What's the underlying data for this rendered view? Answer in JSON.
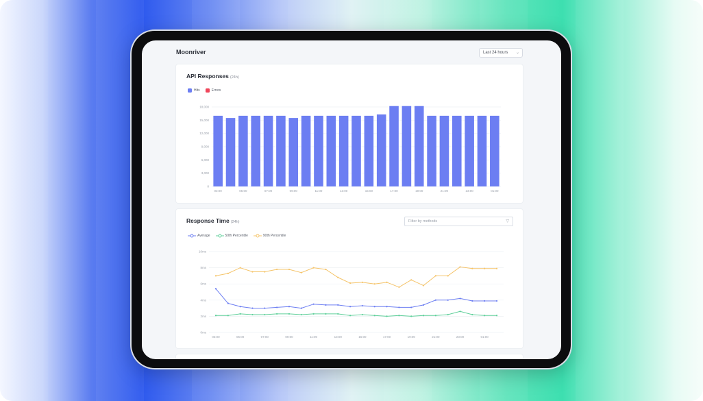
{
  "app": {
    "title": "Moonriver",
    "time_range": "Last 24 hours"
  },
  "colors": {
    "hits": "#6c7ef2",
    "errors": "#f0455a",
    "average": "#6c7ef2",
    "p50": "#5fcf9a",
    "p90": "#f5c46a"
  },
  "api_card": {
    "title": "API Responses",
    "subtitle": "(24h)",
    "legend": [
      "Hits",
      "Errors"
    ]
  },
  "response_card": {
    "title": "Response Time",
    "subtitle": "(24h)",
    "filter_placeholder": "Filter by methods",
    "legend": [
      "Average",
      "50th Percentile",
      "90th Percentile"
    ]
  },
  "chart_data": [
    {
      "type": "bar",
      "title": "API Responses",
      "categories": [
        "03:00",
        "04:00",
        "05:00",
        "06:00",
        "07:00",
        "08:00",
        "09:00",
        "10:00",
        "11:00",
        "12:00",
        "13:00",
        "14:00",
        "15:00",
        "16:00",
        "17:00",
        "18:00",
        "19:00",
        "20:00",
        "21:00",
        "22:00",
        "23:00",
        "00:00",
        "01:00"
      ],
      "x_tick_labels": [
        "03:00",
        "05:00",
        "07:00",
        "09:00",
        "11:00",
        "13:00",
        "15:00",
        "17:00",
        "19:00",
        "21:00",
        "23:00",
        "01:00"
      ],
      "series": [
        {
          "name": "Hits",
          "values": [
            16000,
            15500,
            16000,
            16000,
            16000,
            16000,
            15500,
            16000,
            16000,
            16000,
            16000,
            16000,
            16000,
            16300,
            18200,
            18200,
            18200,
            16000,
            16000,
            16000,
            16000,
            16000,
            16000
          ]
        },
        {
          "name": "Errors",
          "values": [
            0,
            0,
            0,
            0,
            0,
            0,
            0,
            0,
            0,
            0,
            0,
            0,
            0,
            0,
            0,
            0,
            0,
            0,
            0,
            0,
            0,
            0,
            0
          ]
        }
      ],
      "y_ticks": [
        "0",
        "3,000",
        "6,000",
        "9,000",
        "12,000",
        "15,000",
        "18,000"
      ],
      "ylim": [
        0,
        18000
      ],
      "grid": true,
      "legend_position": "top-left"
    },
    {
      "type": "line",
      "title": "Response Time",
      "x": [
        "03:00",
        "04:00",
        "05:00",
        "06:00",
        "07:00",
        "08:00",
        "09:00",
        "10:00",
        "11:00",
        "12:00",
        "13:00",
        "14:00",
        "15:00",
        "16:00",
        "17:00",
        "18:00",
        "19:00",
        "20:00",
        "21:00",
        "22:00",
        "23:00",
        "00:00",
        "01:00",
        "02:00"
      ],
      "x_tick_labels": [
        "03:00",
        "05:00",
        "07:00",
        "09:00",
        "11:00",
        "13:00",
        "15:00",
        "17:00",
        "19:00",
        "21:00",
        "23:00",
        "01:00"
      ],
      "series": [
        {
          "name": "Average",
          "values": [
            5.4,
            3.6,
            3.2,
            3.0,
            3.0,
            3.1,
            3.2,
            3.0,
            3.5,
            3.4,
            3.4,
            3.2,
            3.3,
            3.2,
            3.2,
            3.1,
            3.1,
            3.4,
            4.0,
            4.0,
            4.2,
            3.9,
            3.9,
            3.9
          ]
        },
        {
          "name": "50th Percentile",
          "values": [
            2.1,
            2.1,
            2.3,
            2.2,
            2.2,
            2.3,
            2.3,
            2.2,
            2.3,
            2.3,
            2.3,
            2.1,
            2.2,
            2.1,
            2.0,
            2.1,
            2.0,
            2.1,
            2.1,
            2.2,
            2.6,
            2.2,
            2.1,
            2.1
          ]
        },
        {
          "name": "90th Percentile",
          "values": [
            7.0,
            7.3,
            8.0,
            7.5,
            7.5,
            7.8,
            7.8,
            7.4,
            8.0,
            7.8,
            6.8,
            6.1,
            6.2,
            6.0,
            6.2,
            5.6,
            6.5,
            5.8,
            7.0,
            7.0,
            8.1,
            7.9,
            7.9,
            7.9
          ]
        }
      ],
      "y_ticks": [
        "0ms",
        "2ms",
        "4ms",
        "6ms",
        "8ms",
        "10ms"
      ],
      "ylim": [
        0,
        10
      ],
      "grid": true,
      "legend_position": "top-left"
    }
  ]
}
